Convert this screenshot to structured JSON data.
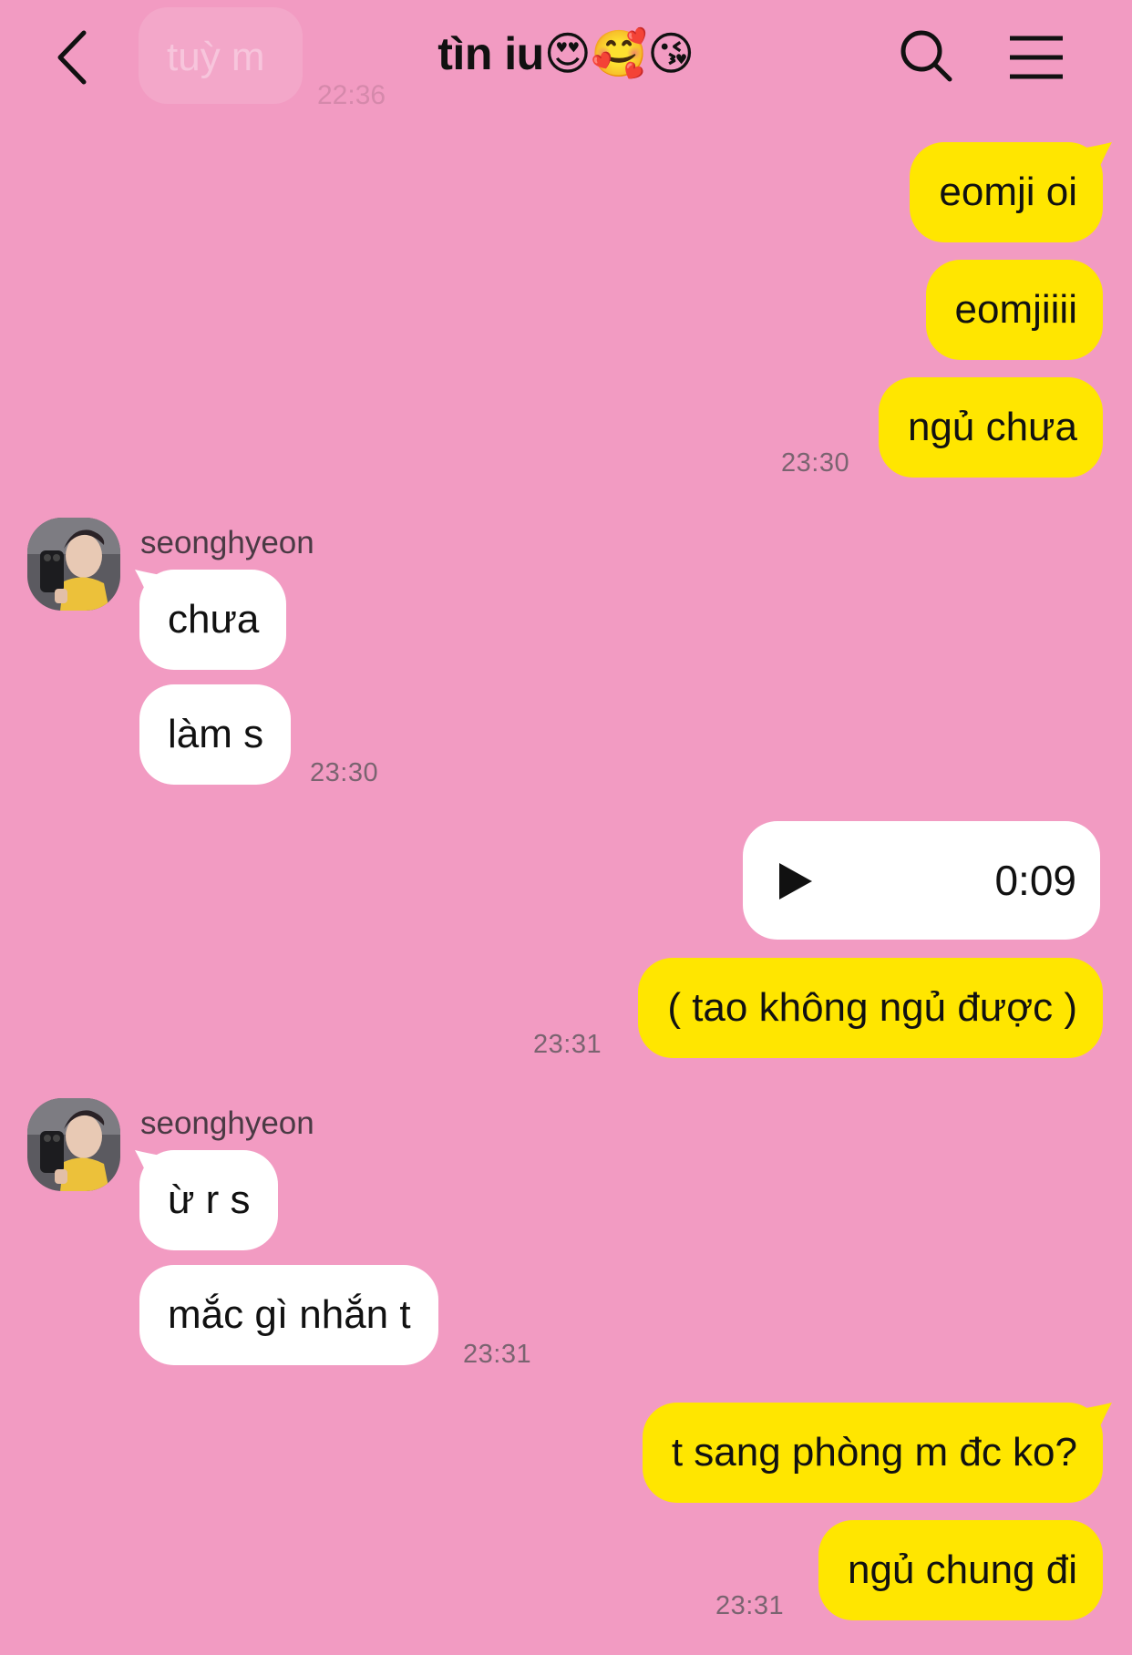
{
  "header": {
    "title": "tìn iu😍🥰😘",
    "faded_preview_text": "tuỳ m",
    "faded_preview_time": "22:36"
  },
  "colors": {
    "background": "#f29bc2",
    "my_bubble": "#ffe600",
    "their_bubble": "#ffffff"
  },
  "icons": {
    "back": "chevron-left-icon",
    "search": "search-icon",
    "menu": "hamburger-menu-icon",
    "play": "play-icon"
  },
  "messages": {
    "m1": "eomji oi",
    "m2": "eomjiiii",
    "m3": "ngủ chưa",
    "m3_time": "23:30",
    "g1_sender": "seonghyeon",
    "r1": "chưa",
    "r2": "làm s",
    "r2_time": "23:30",
    "voice_duration": "0:09",
    "m4": "( tao không ngủ được )",
    "m4_time": "23:31",
    "g2_sender": "seonghyeon",
    "r3": "ừ r s",
    "r4": "mắc gì nhắn t",
    "r4_time": "23:31",
    "m5": "t sang phòng m đc ko?",
    "m6": "ngủ chung đi",
    "m6_time": "23:31"
  }
}
